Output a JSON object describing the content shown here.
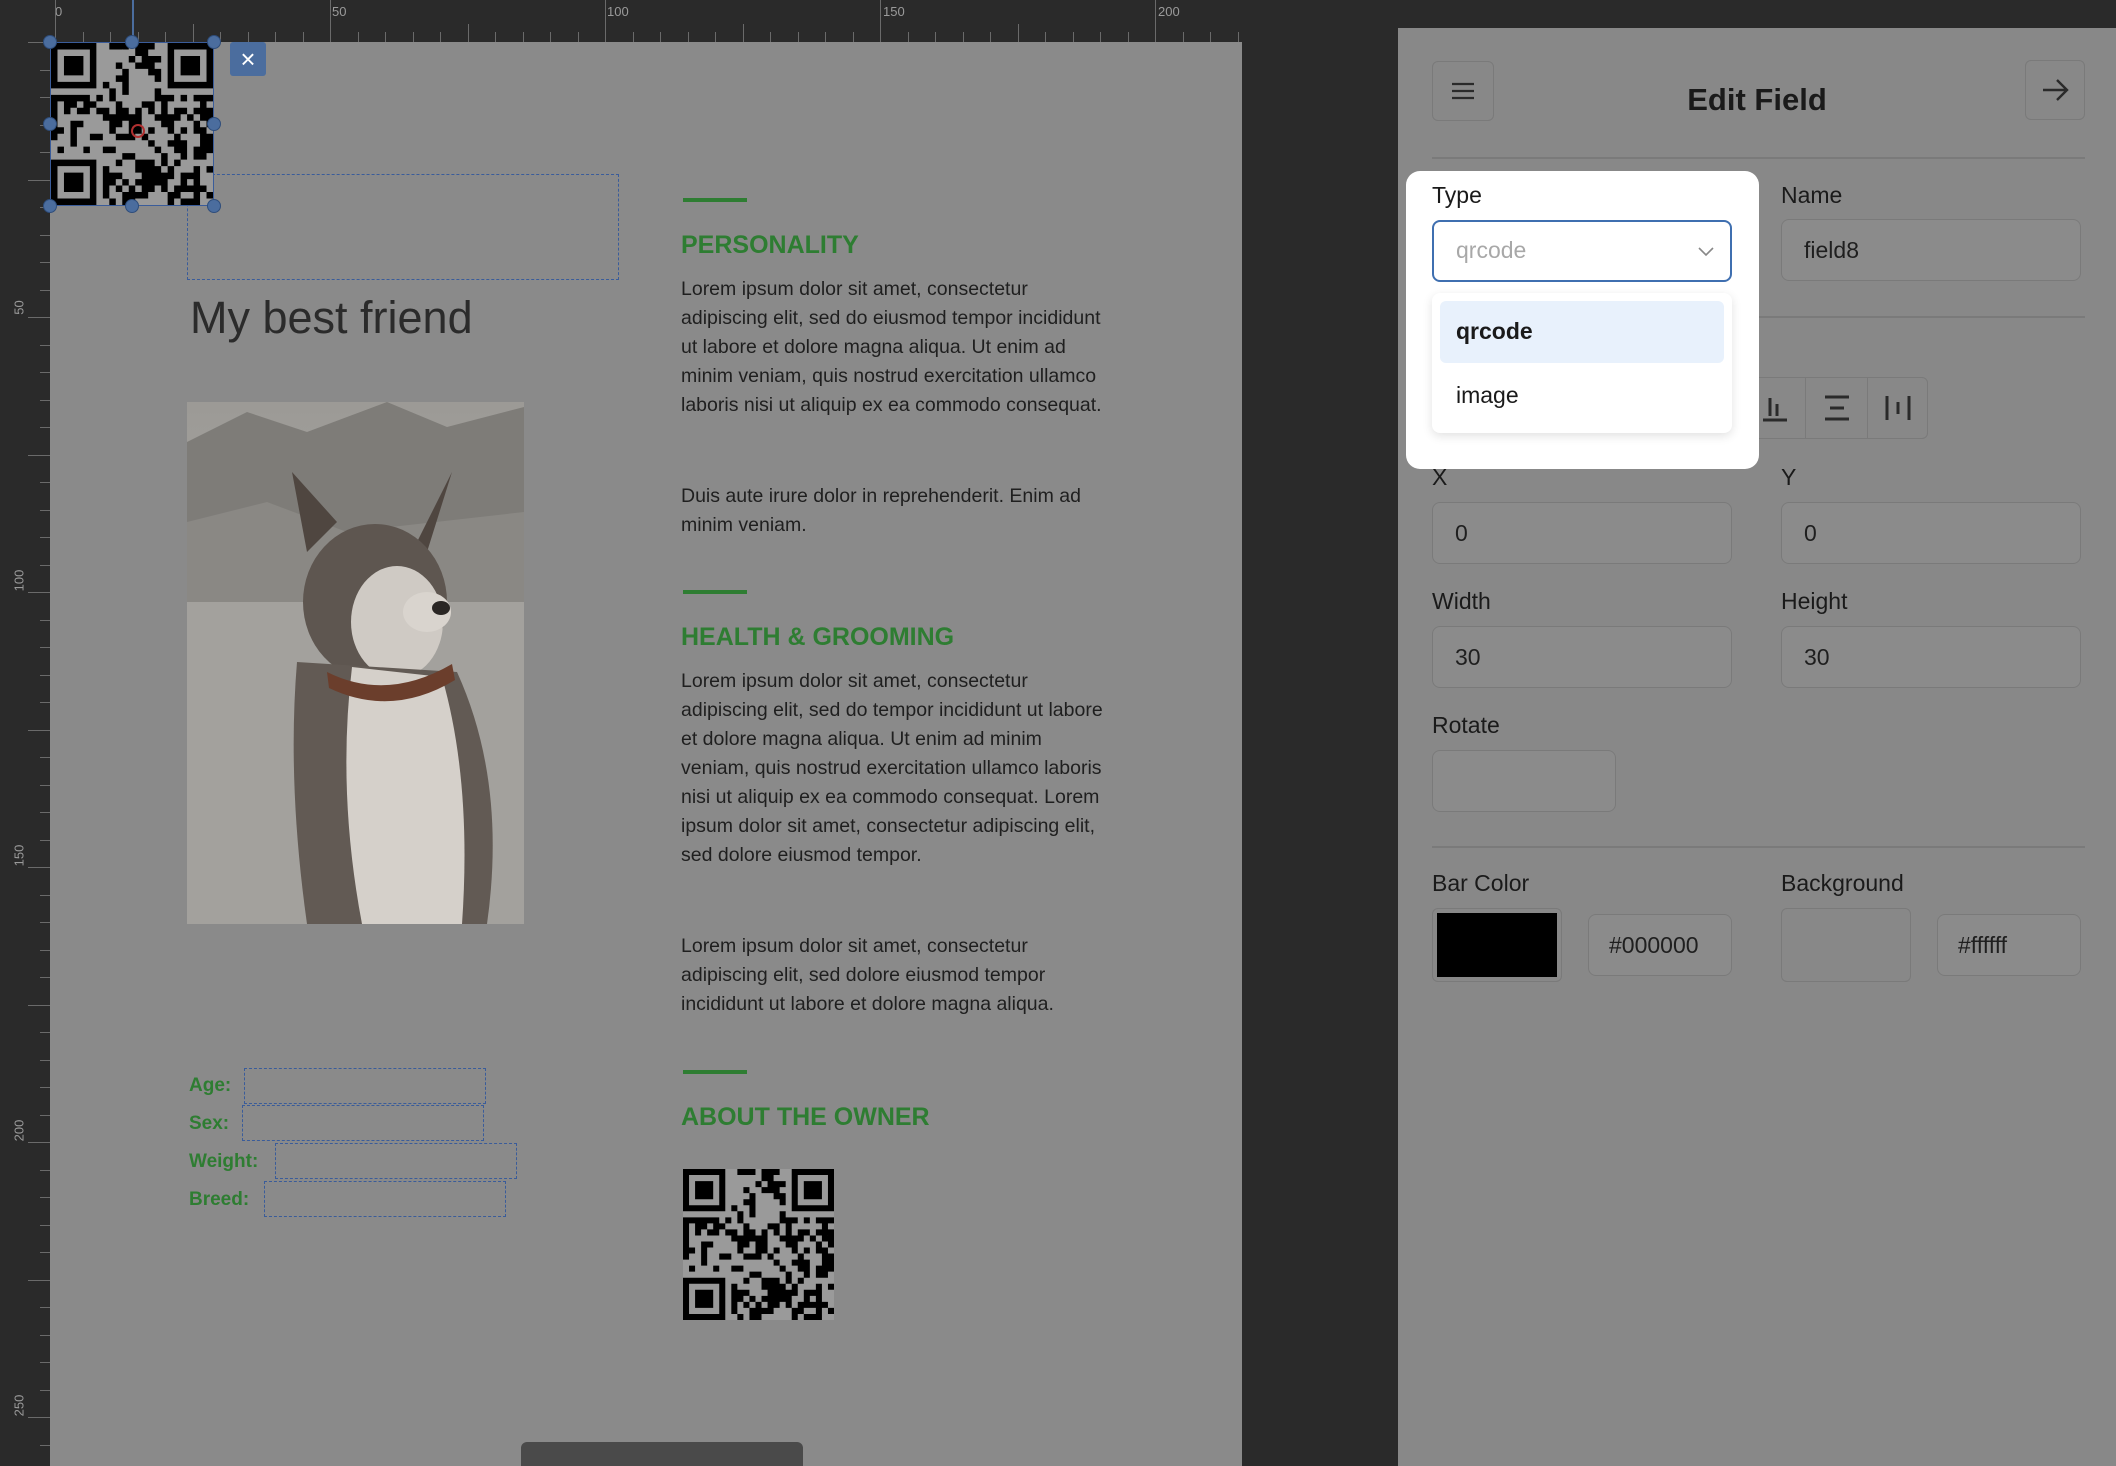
{
  "ruler": {
    "top_labels": [
      "0",
      "50",
      "100",
      "150",
      "200"
    ],
    "left_labels": [
      "50",
      "100",
      "150",
      "200",
      "250"
    ]
  },
  "document": {
    "title": "My best friend",
    "sections": [
      {
        "heading": "PERSONALITY",
        "paragraphs": [
          "Lorem ipsum dolor sit amet, consectetur adipiscing elit, sed do eiusmod tempor incididunt ut labore et dolore magna aliqua. Ut enim ad minim veniam, quis nostrud exercitation ullamco laboris nisi ut aliquip ex ea commodo consequat.",
          "Duis aute irure dolor in reprehenderit. Enim ad minim veniam."
        ]
      },
      {
        "heading": "HEALTH & GROOMING",
        "paragraphs": [
          "Lorem ipsum dolor sit amet, consectetur adipiscing elit, sed do tempor incididunt ut labore et dolore magna aliqua. Ut enim ad minim veniam, quis nostrud exercitation ullamco laboris nisi ut aliquip ex ea commodo consequat. Lorem ipsum dolor sit amet, consectetur adipiscing elit, sed dolore eiusmod tempor.",
          "Lorem ipsum dolor sit amet, consectetur adipiscing elit, sed dolore eiusmod tempor incididunt ut labore et dolore magna aliqua."
        ]
      },
      {
        "heading": "ABOUT THE OWNER",
        "paragraphs": []
      }
    ],
    "fields": [
      "Age:",
      "Sex:",
      "Weight:",
      "Breed:"
    ]
  },
  "panel": {
    "title": "Edit Field",
    "type_label": "Type",
    "type_value": "qrcode",
    "type_options": [
      "qrcode",
      "image"
    ],
    "name_label": "Name",
    "name_value": "field8",
    "x_label": "X",
    "x_value": "0",
    "y_label": "Y",
    "y_value": "0",
    "width_label": "Width",
    "width_value": "30",
    "height_label": "Height",
    "height_value": "30",
    "rotate_label": "Rotate",
    "rotate_value": "",
    "bar_color_label": "Bar Color",
    "bar_color_value": "#000000",
    "background_label": "Background",
    "background_value": "#ffffff"
  },
  "colors": {
    "accent_green": "#2e7d32",
    "selection_blue": "#4b6d9e",
    "dropdown_highlight": "#e8f1fc"
  }
}
